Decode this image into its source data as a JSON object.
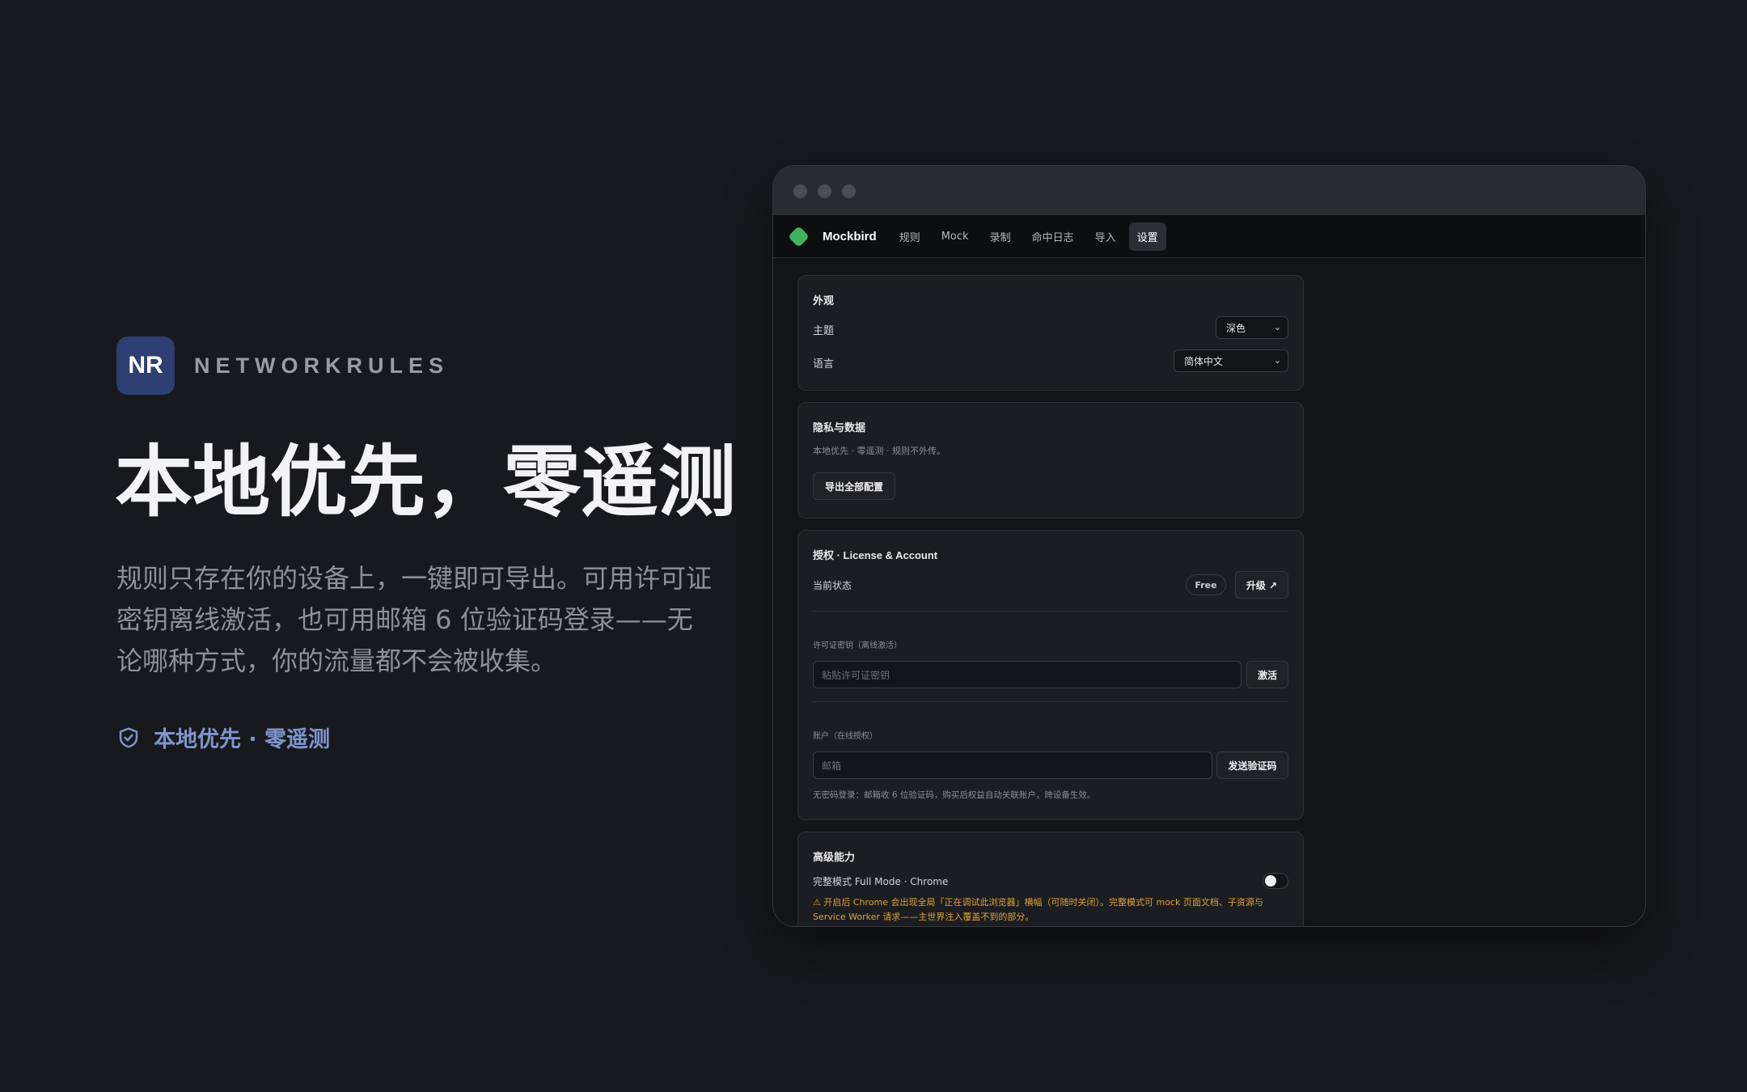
{
  "brand": {
    "logo_text": "NR",
    "name": "NETWORKRULES"
  },
  "hero": {
    "headline": "本地优先，零遥测",
    "description": "规则只存在你的设备上，一键即可导出。可用许可证密钥离线激活，也可用邮箱 6 位验证码登录——无论哪种方式，你的流量都不会被收集。",
    "tag": "本地优先 · 零遥测",
    "tag_icon": "shield-check-icon"
  },
  "app": {
    "name": "Mockbird",
    "nav": [
      {
        "label": "规则"
      },
      {
        "label": "Mock"
      },
      {
        "label": "录制"
      },
      {
        "label": "命中日志"
      },
      {
        "label": "导入"
      },
      {
        "label": "设置",
        "active": true
      }
    ]
  },
  "settings": {
    "appearance": {
      "title": "外观",
      "theme_label": "主题",
      "theme_value": "深色",
      "language_label": "语言",
      "language_value": "简体中文"
    },
    "privacy": {
      "title": "隐私与数据",
      "description": "本地优先 · 零遥测 · 规则不外传。",
      "export_button": "导出全部配置"
    },
    "license": {
      "title": "授权 · License & Account",
      "status_label": "当前状态",
      "status_badge": "Free",
      "upgrade_button": "升级 ↗",
      "key_label": "许可证密钥（离线激活）",
      "key_placeholder": "粘贴许可证密钥",
      "activate_button": "激活",
      "account_label": "账户（在线授权）",
      "email_placeholder": "邮箱",
      "send_code_button": "发送验证码",
      "hint": "无密码登录：邮箱收 6 位验证码，购买后权益自动关联账户，跨设备生效。"
    },
    "advanced": {
      "title": "高级能力",
      "full_mode_label": "完整模式 Full Mode · Chrome",
      "full_mode_enabled": false,
      "warning": "⚠ 开启后 Chrome 会出现全局「正在调试此浏览器」横幅（可随时关闭）。完整模式可 mock 页面文档、子资源与 Service Worker 请求——主世界注入覆盖不到的部分。"
    }
  },
  "colors": {
    "background": "#18191c",
    "accent_green": "#3fb45f",
    "logo_blue": "#2e3f73",
    "tag_blue": "#7f95cf",
    "warning": "#d9a23c"
  }
}
